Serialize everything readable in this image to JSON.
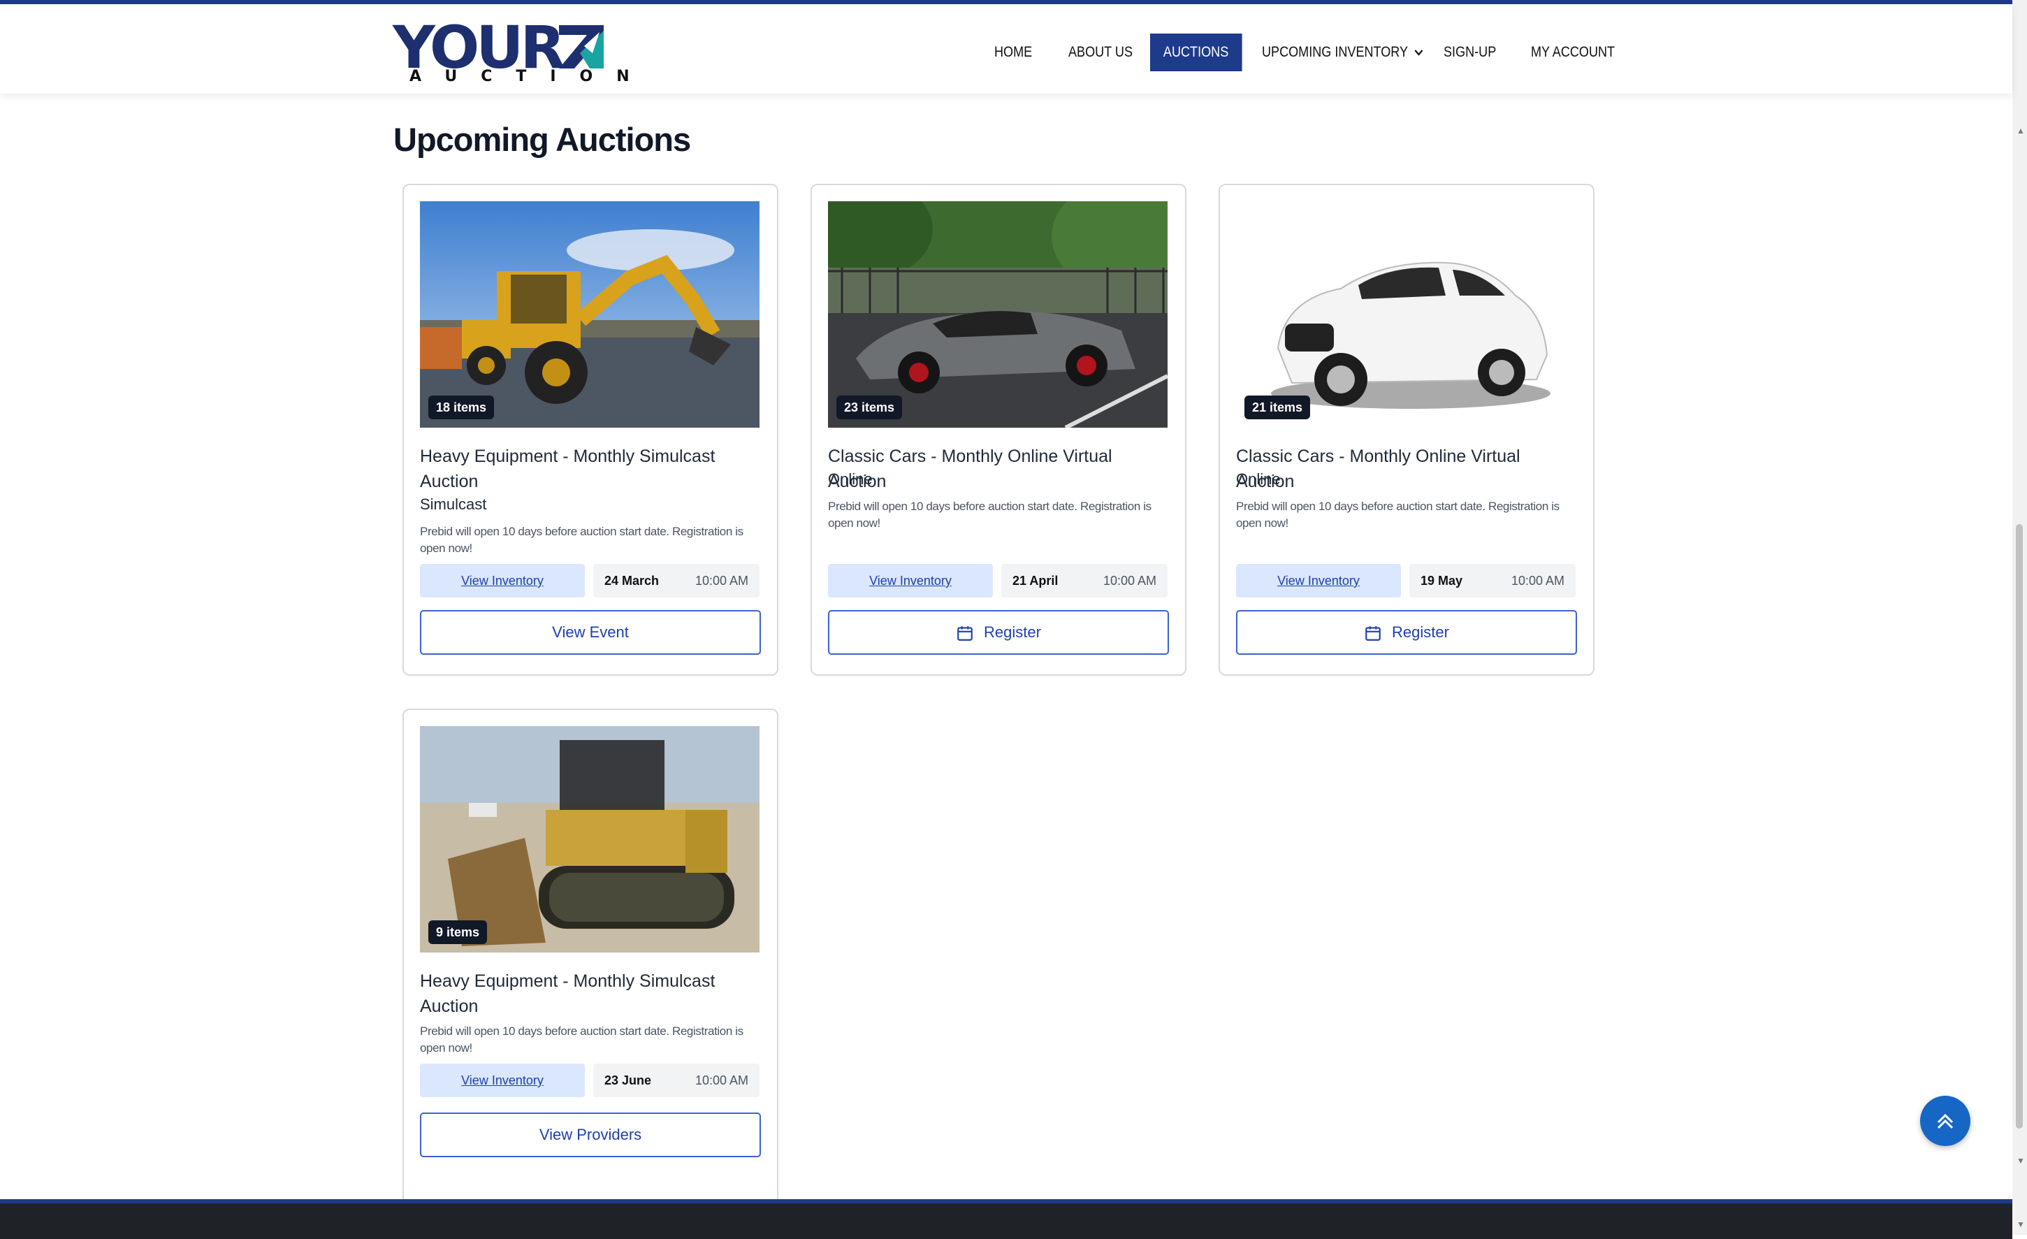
{
  "brand": {
    "logo_main": "YOUR",
    "logo_sub": "AUCTION"
  },
  "nav": {
    "home": "HOME",
    "about": "ABOUT US",
    "auctions": "AUCTIONS",
    "upcoming": "UPCOMING INVENTORY",
    "signup": "SIGN-UP",
    "account": "MY ACCOUNT"
  },
  "page": {
    "title": "Upcoming Auctions"
  },
  "cards": [
    {
      "badge": "18 items",
      "image": "backhoe-loader",
      "title": "Heavy Equipment - Monthly Simulcast Auction",
      "type": "Simulcast",
      "note": "Prebid will open 10 days before auction start date. Registration is open now!",
      "inventory_label": "View Inventory",
      "date": "24 March",
      "time": "10:00 AM",
      "action": "View Event"
    },
    {
      "badge": "23 items",
      "image": "sports-car-grey",
      "title": "Classic Cars - Monthly Online Virtual Auction",
      "type": "Online",
      "note": "Prebid will open 10 days before auction start date. Registration is open now!",
      "inventory_label": "View Inventory",
      "date": "21 April",
      "time": "10:00 AM",
      "action": "Register"
    },
    {
      "badge": "21 items",
      "image": "white-suv",
      "title": "Classic Cars - Monthly Online Virtual Auction",
      "type": "Online",
      "note": "Prebid will open 10 days before auction start date. Registration is open now!",
      "inventory_label": "View Inventory",
      "date": "19 May",
      "time": "10:00 AM",
      "action": "Register"
    },
    {
      "badge": "9 items",
      "image": "bulldozer",
      "title": "Heavy Equipment - Monthly Simulcast Auction",
      "type": "",
      "note": "Prebid will open 10 days before auction start date. Registration is open now!",
      "inventory_label": "View Inventory",
      "date": "23 June",
      "time": "10:00 AM",
      "action": "View Providers"
    }
  ],
  "icons": {
    "calendar": "calendar-icon",
    "back_to_top": "double-chevron-up-icon",
    "nav_dropdown": "chevron-down-icon"
  },
  "colors": {
    "brand_navy": "#1e3a8a",
    "accent_blue": "#1666c5",
    "inventory_bg": "#dbe7ff"
  }
}
